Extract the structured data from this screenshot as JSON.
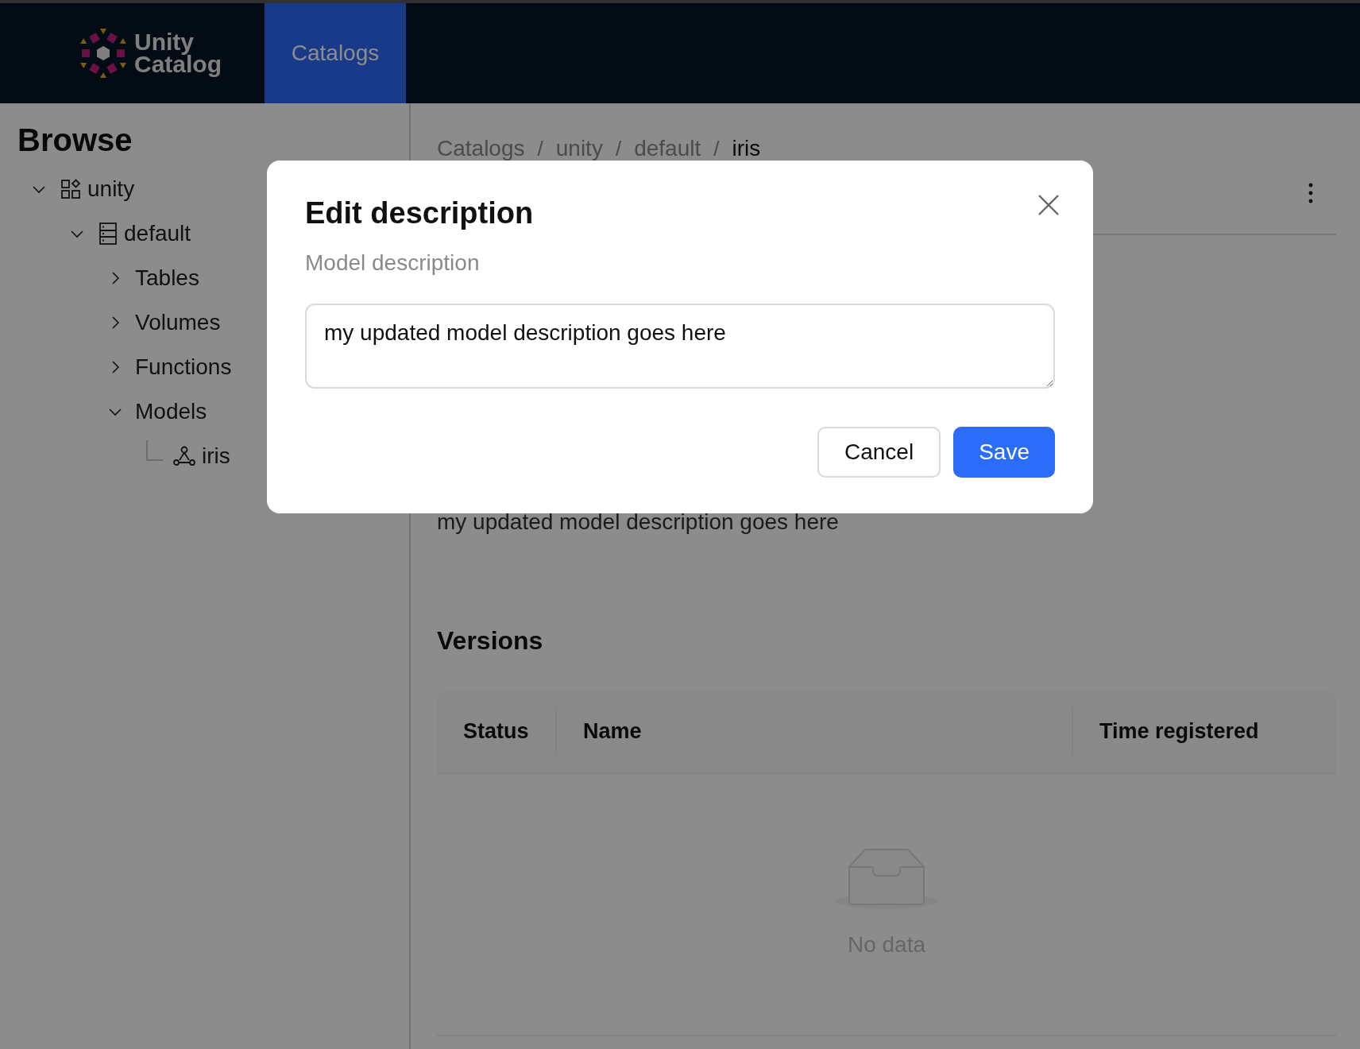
{
  "header": {
    "logo_lines": [
      "Unity",
      "Catalog"
    ],
    "nav": [
      {
        "label": "Catalogs",
        "selected": true
      }
    ]
  },
  "sidebar": {
    "title": "Browse",
    "tree": [
      {
        "label": "unity",
        "kind": "catalog",
        "expanded": true,
        "children": [
          {
            "label": "default",
            "kind": "schema",
            "expanded": true,
            "children": [
              {
                "label": "Tables",
                "kind": "group",
                "expanded": false
              },
              {
                "label": "Volumes",
                "kind": "group",
                "expanded": false
              },
              {
                "label": "Functions",
                "kind": "group",
                "expanded": false
              },
              {
                "label": "Models",
                "kind": "group",
                "expanded": true,
                "children": [
                  {
                    "label": "iris",
                    "kind": "model"
                  }
                ]
              }
            ]
          }
        ]
      }
    ]
  },
  "breadcrumb": {
    "items": [
      "Catalogs",
      "unity",
      "default",
      "iris"
    ],
    "separator": "/"
  },
  "main": {
    "description": "my updated model description goes here",
    "versions": {
      "title": "Versions",
      "columns": [
        "Status",
        "Name",
        "Time registered"
      ],
      "empty_text": "No data"
    }
  },
  "modal": {
    "title": "Edit description",
    "label": "Model description",
    "value": "my updated model description goes here",
    "buttons": [
      {
        "label": "Cancel",
        "kind": "secondary"
      },
      {
        "label": "Save",
        "kind": "primary"
      }
    ]
  }
}
